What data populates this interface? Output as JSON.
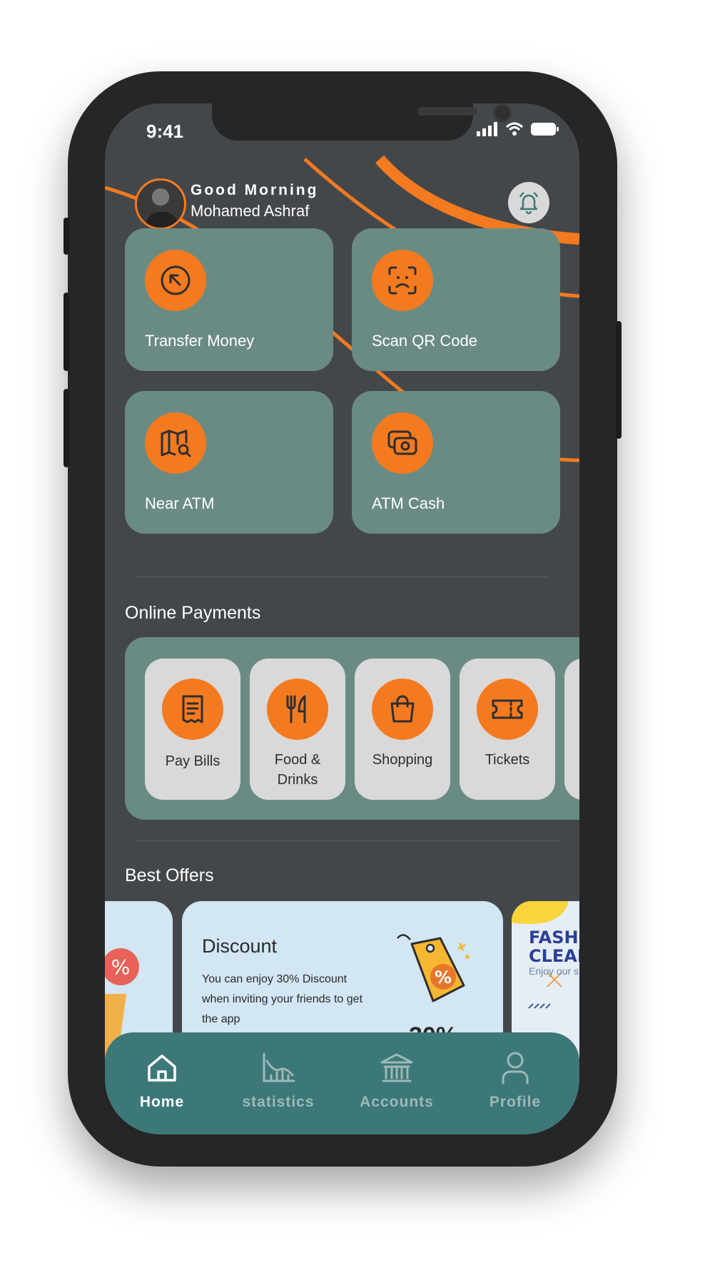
{
  "status_bar": {
    "time": "9:41"
  },
  "header": {
    "greeting": "Good Morning",
    "user_name": "Mohamed Ashraf"
  },
  "actions": [
    {
      "label": "Transfer Money",
      "icon": "arrow-up-left-icon"
    },
    {
      "label": "Scan QR Code",
      "icon": "face-scan-icon"
    },
    {
      "label": "Near ATM",
      "icon": "map-search-icon"
    },
    {
      "label": "ATM Cash",
      "icon": "cash-icon"
    }
  ],
  "online_payments": {
    "title": "Online Payments",
    "items": [
      {
        "label": "Pay Bills",
        "icon": "receipt-icon"
      },
      {
        "label": "Food &\nDrinks",
        "icon": "fork-knife-icon"
      },
      {
        "label": "Shopping",
        "icon": "shopping-bag-icon"
      },
      {
        "label": "Tickets",
        "icon": "ticket-icon"
      }
    ]
  },
  "best_offers": {
    "title": "Best Offers",
    "discount": {
      "title": "Discount",
      "description": "You can enjoy 30% Discount when inviting your friends to get the app",
      "badge": "%",
      "big_text": "30%"
    },
    "fashion": {
      "title": "FASHION CLEARANCE",
      "subtitle": "Enjoy our s"
    }
  },
  "bottom_nav": [
    {
      "label": "Home",
      "icon": "home-icon",
      "active": true
    },
    {
      "label": "statistics",
      "icon": "chart-icon",
      "active": false
    },
    {
      "label": "Accounts",
      "icon": "bank-icon",
      "active": false
    },
    {
      "label": "Profile",
      "icon": "user-icon",
      "active": false
    }
  ],
  "colors": {
    "accent": "#f47a20",
    "card": "#6a8b84",
    "background": "#44474a",
    "nav": "#3d7878"
  }
}
